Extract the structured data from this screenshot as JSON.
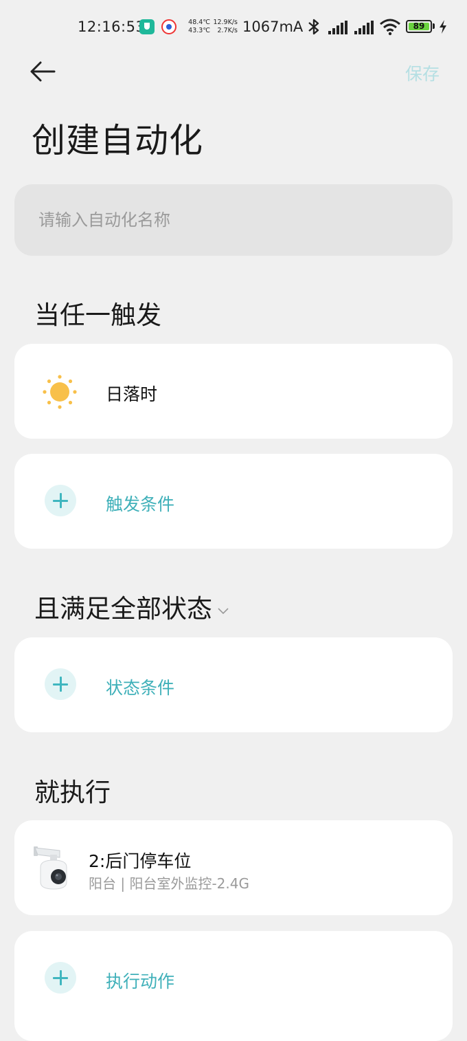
{
  "status_bar": {
    "time": "12:16:53",
    "temp_top": "48.4℃",
    "temp_bottom": "43.3℃",
    "net_up": "12.9K/s",
    "net_down": "2.7K/s",
    "current": "1067mA",
    "battery": "89"
  },
  "header": {
    "save_label": "保存",
    "title": "创建自动化"
  },
  "name_input": {
    "placeholder": "请输入自动化名称",
    "value": ""
  },
  "trigger_section": {
    "heading": "当任一触发",
    "trigger_item": {
      "icon": "sun-icon",
      "label": "日落时"
    },
    "add_label": "触发条件"
  },
  "condition_section": {
    "heading": "且满足全部状态",
    "add_label": "状态条件"
  },
  "action_section": {
    "heading": "就执行",
    "device": {
      "icon": "camera-icon",
      "name": "2:后门停车位",
      "location": "阳台 | 阳台室外监控-2.4G"
    },
    "add_label": "执行动作"
  },
  "colors": {
    "background": "#f0f0f0",
    "accent": "#3fb0b9",
    "save_disabled": "#b5dfe3"
  }
}
